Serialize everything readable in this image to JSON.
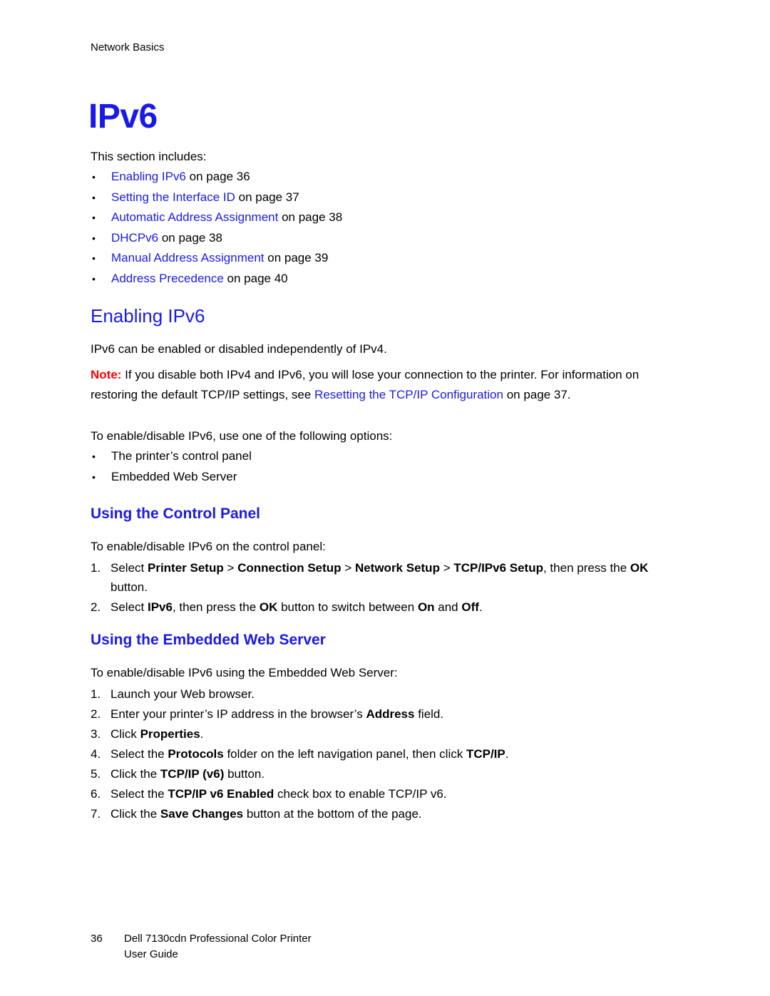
{
  "page": {
    "running_header": "Network Basics",
    "chapter_title": "IPv6"
  },
  "intro": {
    "lead": "This section includes:",
    "links": [
      {
        "link": "Enabling IPv6",
        "suffix": " on page 36"
      },
      {
        "link": "Setting the Interface ID",
        "suffix": " on page 37"
      },
      {
        "link": "Automatic Address Assignment",
        "suffix": " on page 38"
      },
      {
        "link": "DHCPv6",
        "suffix": " on page 38"
      },
      {
        "link": "Manual Address Assignment",
        "suffix": " on page 39"
      },
      {
        "link": "Address Precedence",
        "suffix": " on page 40"
      }
    ]
  },
  "enabling": {
    "heading": "Enabling IPv6",
    "intro": "IPv6 can be enabled or disabled independently of IPv4.",
    "note": {
      "label": "Note:",
      "text_before_link": " If you disable both IPv4 and IPv6, you will lose your connection to the printer. For information on restoring the default TCP/IP settings, see ",
      "link": "Resetting the TCP/IP Configuration",
      "text_after_link": " on page 37."
    },
    "options_lead": "To enable/disable IPv6, use one of the following options:",
    "options": [
      "The printer’s control panel",
      "Embedded Web Server"
    ]
  },
  "control_panel": {
    "heading": "Using the Control Panel",
    "lead": "To enable/disable IPv6 on the control panel:",
    "step1": {
      "t1": "Select ",
      "b1": "Printer Setup",
      "t2": " > ",
      "b2": "Connection Setup",
      "t3": " > ",
      "b3": "Network Setup",
      "t4": " > ",
      "b4": "TCP/IPv6 Setup",
      "t5": ", then press the ",
      "b5": "OK",
      "t6": " button."
    },
    "step2": {
      "t1": "Select ",
      "b1": "IPv6",
      "t2": ", then press the ",
      "b2": "OK",
      "t3": " button to switch between ",
      "b3": "On",
      "t4": " and ",
      "b4": "Off",
      "t5": "."
    }
  },
  "web_server": {
    "heading": "Using the Embedded Web Server",
    "lead": "To enable/disable IPv6 using the Embedded Web Server:",
    "step1": {
      "t1": "Launch your Web browser."
    },
    "step2": {
      "t1": "Enter your printer’s IP address in the browser’s ",
      "b1": "Address",
      "t2": " field."
    },
    "step3": {
      "t1": "Click ",
      "b1": "Properties",
      "t2": "."
    },
    "step4": {
      "t1": "Select the ",
      "b1": "Protocols",
      "t2": " folder on the left navigation panel, then click ",
      "b2": "TCP/IP",
      "t3": "."
    },
    "step5": {
      "t1": "Click the ",
      "b1": "TCP/IP (v6)",
      "t2": " button."
    },
    "step6": {
      "t1": "Select the ",
      "b1": "TCP/IP v6 Enabled",
      "t2": " check box to enable TCP/IP v6."
    },
    "step7": {
      "t1": "Click the ",
      "b1": "Save Changes",
      "t2": " button at the bottom of the page."
    }
  },
  "footer": {
    "page_number": "36",
    "line1": "Dell 7130cdn Professional Color Printer",
    "line2": "User Guide"
  },
  "colors": {
    "link": "#1a1ae6",
    "heading": "#1a1ae6",
    "note": "#ff0000",
    "text": "#000000",
    "background": "#ffffff"
  }
}
